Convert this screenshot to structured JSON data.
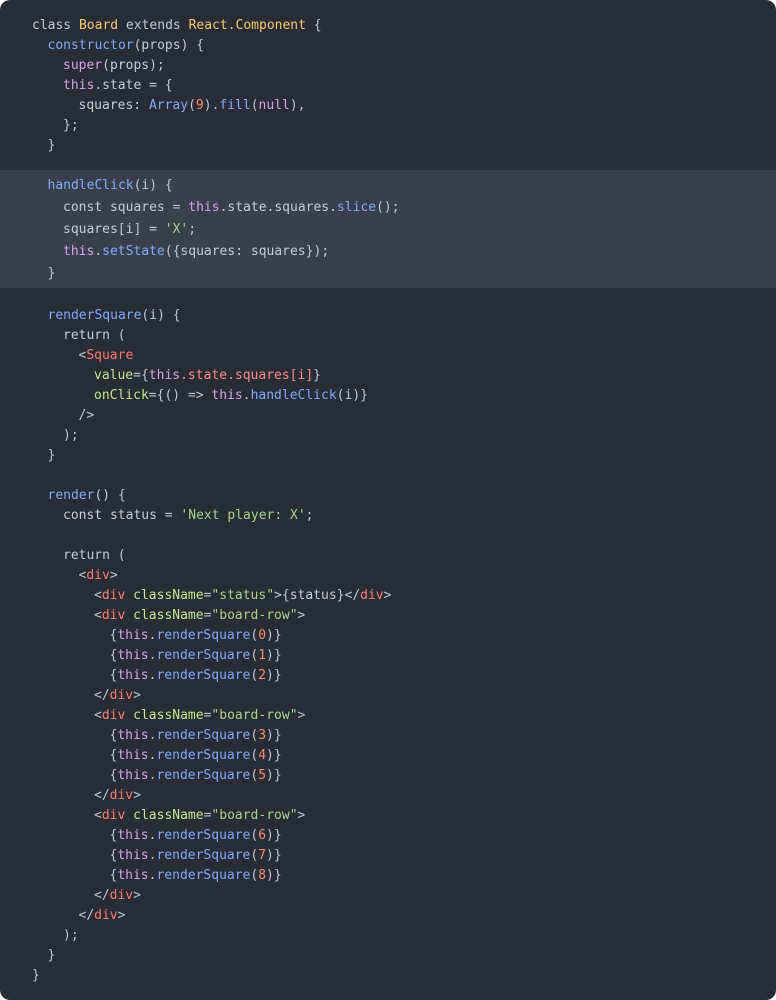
{
  "editor": {
    "highlight": {
      "from_line": 9,
      "to_line": 13
    },
    "lines": [
      {
        "indent": 0,
        "tokens": [
          {
            "t": "class ",
            "c": "keyword"
          },
          {
            "t": "Board",
            "c": "class"
          },
          {
            "t": " extends ",
            "c": "keyword"
          },
          {
            "t": "React.Component",
            "c": "class"
          },
          {
            "t": " {",
            "c": "punct"
          }
        ]
      },
      {
        "indent": 1,
        "tokens": [
          {
            "t": "constructor",
            "c": "method"
          },
          {
            "t": "(",
            "c": "punct"
          },
          {
            "t": "props",
            "c": "plain"
          },
          {
            "t": ") {",
            "c": "punct"
          }
        ]
      },
      {
        "indent": 2,
        "tokens": [
          {
            "t": "super",
            "c": "this"
          },
          {
            "t": "(",
            "c": "punct"
          },
          {
            "t": "props",
            "c": "plain"
          },
          {
            "t": ");",
            "c": "punct"
          }
        ]
      },
      {
        "indent": 2,
        "tokens": [
          {
            "t": "this",
            "c": "this"
          },
          {
            "t": ".state = {",
            "c": "plain"
          }
        ]
      },
      {
        "indent": 3,
        "tokens": [
          {
            "t": "squares",
            "c": "plain"
          },
          {
            "t": ": ",
            "c": "punct"
          },
          {
            "t": "Array",
            "c": "method"
          },
          {
            "t": "(",
            "c": "punct"
          },
          {
            "t": "9",
            "c": "number"
          },
          {
            "t": ").",
            "c": "punct"
          },
          {
            "t": "fill",
            "c": "method"
          },
          {
            "t": "(",
            "c": "punct"
          },
          {
            "t": "null",
            "c": "this"
          },
          {
            "t": "),",
            "c": "punct"
          }
        ]
      },
      {
        "indent": 2,
        "tokens": [
          {
            "t": "};",
            "c": "punct"
          }
        ]
      },
      {
        "indent": 1,
        "tokens": [
          {
            "t": "}",
            "c": "punct"
          }
        ]
      },
      {
        "indent": 0,
        "tokens": []
      },
      {
        "indent": 1,
        "tokens": [
          {
            "t": "handleClick",
            "c": "method"
          },
          {
            "t": "(",
            "c": "punct"
          },
          {
            "t": "i",
            "c": "plain"
          },
          {
            "t": ") {",
            "c": "punct"
          }
        ]
      },
      {
        "indent": 2,
        "tokens": [
          {
            "t": "const ",
            "c": "keyword"
          },
          {
            "t": "squares",
            "c": "plain"
          },
          {
            "t": " = ",
            "c": "punct"
          },
          {
            "t": "this",
            "c": "this"
          },
          {
            "t": ".state.squares.",
            "c": "plain"
          },
          {
            "t": "slice",
            "c": "method"
          },
          {
            "t": "();",
            "c": "punct"
          }
        ]
      },
      {
        "indent": 2,
        "tokens": [
          {
            "t": "squares",
            "c": "plain"
          },
          {
            "t": "[",
            "c": "punct"
          },
          {
            "t": "i",
            "c": "plain"
          },
          {
            "t": "] = ",
            "c": "punct"
          },
          {
            "t": "'X'",
            "c": "string"
          },
          {
            "t": ";",
            "c": "punct"
          }
        ]
      },
      {
        "indent": 2,
        "tokens": [
          {
            "t": "this",
            "c": "this"
          },
          {
            "t": ".",
            "c": "punct"
          },
          {
            "t": "setState",
            "c": "method"
          },
          {
            "t": "({",
            "c": "punct"
          },
          {
            "t": "squares",
            "c": "plain"
          },
          {
            "t": ": ",
            "c": "punct"
          },
          {
            "t": "squares",
            "c": "plain"
          },
          {
            "t": "});",
            "c": "punct"
          }
        ]
      },
      {
        "indent": 1,
        "tokens": [
          {
            "t": "}",
            "c": "punct"
          }
        ]
      },
      {
        "indent": 0,
        "tokens": []
      },
      {
        "indent": 1,
        "tokens": [
          {
            "t": "renderSquare",
            "c": "method"
          },
          {
            "t": "(",
            "c": "punct"
          },
          {
            "t": "i",
            "c": "plain"
          },
          {
            "t": ") {",
            "c": "punct"
          }
        ]
      },
      {
        "indent": 2,
        "tokens": [
          {
            "t": "return ",
            "c": "keyword"
          },
          {
            "t": "(",
            "c": "punct"
          }
        ]
      },
      {
        "indent": 3,
        "tokens": [
          {
            "t": "<",
            "c": "punct"
          },
          {
            "t": "Square",
            "c": "tag"
          }
        ]
      },
      {
        "indent": 4,
        "tokens": [
          {
            "t": "value",
            "c": "attr"
          },
          {
            "t": "={",
            "c": "punct"
          },
          {
            "t": "this",
            "c": "this"
          },
          {
            "t": ".state.squares[i]",
            "c": "prop"
          },
          {
            "t": "}",
            "c": "punct"
          }
        ]
      },
      {
        "indent": 4,
        "tokens": [
          {
            "t": "onClick",
            "c": "attr"
          },
          {
            "t": "={() => ",
            "c": "punct"
          },
          {
            "t": "this",
            "c": "this"
          },
          {
            "t": ".",
            "c": "punct"
          },
          {
            "t": "handleClick",
            "c": "method"
          },
          {
            "t": "(",
            "c": "punct"
          },
          {
            "t": "i",
            "c": "plain"
          },
          {
            "t": ")}",
            "c": "punct"
          }
        ]
      },
      {
        "indent": 3,
        "tokens": [
          {
            "t": "/>",
            "c": "punct"
          }
        ]
      },
      {
        "indent": 2,
        "tokens": [
          {
            "t": ");",
            "c": "punct"
          }
        ]
      },
      {
        "indent": 1,
        "tokens": [
          {
            "t": "}",
            "c": "punct"
          }
        ]
      },
      {
        "indent": 0,
        "tokens": []
      },
      {
        "indent": 1,
        "tokens": [
          {
            "t": "render",
            "c": "method"
          },
          {
            "t": "() {",
            "c": "punct"
          }
        ]
      },
      {
        "indent": 2,
        "tokens": [
          {
            "t": "const ",
            "c": "keyword"
          },
          {
            "t": "status",
            "c": "plain"
          },
          {
            "t": " = ",
            "c": "punct"
          },
          {
            "t": "'Next player: X'",
            "c": "string"
          },
          {
            "t": ";",
            "c": "punct"
          }
        ]
      },
      {
        "indent": 0,
        "tokens": []
      },
      {
        "indent": 2,
        "tokens": [
          {
            "t": "return ",
            "c": "keyword"
          },
          {
            "t": "(",
            "c": "punct"
          }
        ]
      },
      {
        "indent": 3,
        "tokens": [
          {
            "t": "<",
            "c": "punct"
          },
          {
            "t": "div",
            "c": "tag"
          },
          {
            "t": ">",
            "c": "punct"
          }
        ]
      },
      {
        "indent": 4,
        "tokens": [
          {
            "t": "<",
            "c": "punct"
          },
          {
            "t": "div",
            "c": "tag"
          },
          {
            "t": " className",
            "c": "attr"
          },
          {
            "t": "=",
            "c": "punct"
          },
          {
            "t": "\"status\"",
            "c": "string"
          },
          {
            "t": ">{",
            "c": "punct"
          },
          {
            "t": "status",
            "c": "plain"
          },
          {
            "t": "}</",
            "c": "punct"
          },
          {
            "t": "div",
            "c": "tag"
          },
          {
            "t": ">",
            "c": "punct"
          }
        ]
      },
      {
        "indent": 4,
        "tokens": [
          {
            "t": "<",
            "c": "punct"
          },
          {
            "t": "div",
            "c": "tag"
          },
          {
            "t": " className",
            "c": "attr"
          },
          {
            "t": "=",
            "c": "punct"
          },
          {
            "t": "\"board-row\"",
            "c": "string"
          },
          {
            "t": ">",
            "c": "punct"
          }
        ]
      },
      {
        "indent": 5,
        "tokens": [
          {
            "t": "{",
            "c": "punct"
          },
          {
            "t": "this",
            "c": "this"
          },
          {
            "t": ".",
            "c": "punct"
          },
          {
            "t": "renderSquare",
            "c": "method"
          },
          {
            "t": "(",
            "c": "punct"
          },
          {
            "t": "0",
            "c": "number"
          },
          {
            "t": ")}",
            "c": "punct"
          }
        ]
      },
      {
        "indent": 5,
        "tokens": [
          {
            "t": "{",
            "c": "punct"
          },
          {
            "t": "this",
            "c": "this"
          },
          {
            "t": ".",
            "c": "punct"
          },
          {
            "t": "renderSquare",
            "c": "method"
          },
          {
            "t": "(",
            "c": "punct"
          },
          {
            "t": "1",
            "c": "number"
          },
          {
            "t": ")}",
            "c": "punct"
          }
        ]
      },
      {
        "indent": 5,
        "tokens": [
          {
            "t": "{",
            "c": "punct"
          },
          {
            "t": "this",
            "c": "this"
          },
          {
            "t": ".",
            "c": "punct"
          },
          {
            "t": "renderSquare",
            "c": "method"
          },
          {
            "t": "(",
            "c": "punct"
          },
          {
            "t": "2",
            "c": "number"
          },
          {
            "t": ")}",
            "c": "punct"
          }
        ]
      },
      {
        "indent": 4,
        "tokens": [
          {
            "t": "</",
            "c": "punct"
          },
          {
            "t": "div",
            "c": "tag"
          },
          {
            "t": ">",
            "c": "punct"
          }
        ]
      },
      {
        "indent": 4,
        "tokens": [
          {
            "t": "<",
            "c": "punct"
          },
          {
            "t": "div",
            "c": "tag"
          },
          {
            "t": " className",
            "c": "attr"
          },
          {
            "t": "=",
            "c": "punct"
          },
          {
            "t": "\"board-row\"",
            "c": "string"
          },
          {
            "t": ">",
            "c": "punct"
          }
        ]
      },
      {
        "indent": 5,
        "tokens": [
          {
            "t": "{",
            "c": "punct"
          },
          {
            "t": "this",
            "c": "this"
          },
          {
            "t": ".",
            "c": "punct"
          },
          {
            "t": "renderSquare",
            "c": "method"
          },
          {
            "t": "(",
            "c": "punct"
          },
          {
            "t": "3",
            "c": "number"
          },
          {
            "t": ")}",
            "c": "punct"
          }
        ]
      },
      {
        "indent": 5,
        "tokens": [
          {
            "t": "{",
            "c": "punct"
          },
          {
            "t": "this",
            "c": "this"
          },
          {
            "t": ".",
            "c": "punct"
          },
          {
            "t": "renderSquare",
            "c": "method"
          },
          {
            "t": "(",
            "c": "punct"
          },
          {
            "t": "4",
            "c": "number"
          },
          {
            "t": ")}",
            "c": "punct"
          }
        ]
      },
      {
        "indent": 5,
        "tokens": [
          {
            "t": "{",
            "c": "punct"
          },
          {
            "t": "this",
            "c": "this"
          },
          {
            "t": ".",
            "c": "punct"
          },
          {
            "t": "renderSquare",
            "c": "method"
          },
          {
            "t": "(",
            "c": "punct"
          },
          {
            "t": "5",
            "c": "number"
          },
          {
            "t": ")}",
            "c": "punct"
          }
        ]
      },
      {
        "indent": 4,
        "tokens": [
          {
            "t": "</",
            "c": "punct"
          },
          {
            "t": "div",
            "c": "tag"
          },
          {
            "t": ">",
            "c": "punct"
          }
        ]
      },
      {
        "indent": 4,
        "tokens": [
          {
            "t": "<",
            "c": "punct"
          },
          {
            "t": "div",
            "c": "tag"
          },
          {
            "t": " className",
            "c": "attr"
          },
          {
            "t": "=",
            "c": "punct"
          },
          {
            "t": "\"board-row\"",
            "c": "string"
          },
          {
            "t": ">",
            "c": "punct"
          }
        ]
      },
      {
        "indent": 5,
        "tokens": [
          {
            "t": "{",
            "c": "punct"
          },
          {
            "t": "this",
            "c": "this"
          },
          {
            "t": ".",
            "c": "punct"
          },
          {
            "t": "renderSquare",
            "c": "method"
          },
          {
            "t": "(",
            "c": "punct"
          },
          {
            "t": "6",
            "c": "number"
          },
          {
            "t": ")}",
            "c": "punct"
          }
        ]
      },
      {
        "indent": 5,
        "tokens": [
          {
            "t": "{",
            "c": "punct"
          },
          {
            "t": "this",
            "c": "this"
          },
          {
            "t": ".",
            "c": "punct"
          },
          {
            "t": "renderSquare",
            "c": "method"
          },
          {
            "t": "(",
            "c": "punct"
          },
          {
            "t": "7",
            "c": "number"
          },
          {
            "t": ")}",
            "c": "punct"
          }
        ]
      },
      {
        "indent": 5,
        "tokens": [
          {
            "t": "{",
            "c": "punct"
          },
          {
            "t": "this",
            "c": "this"
          },
          {
            "t": ".",
            "c": "punct"
          },
          {
            "t": "renderSquare",
            "c": "method"
          },
          {
            "t": "(",
            "c": "punct"
          },
          {
            "t": "8",
            "c": "number"
          },
          {
            "t": ")}",
            "c": "punct"
          }
        ]
      },
      {
        "indent": 4,
        "tokens": [
          {
            "t": "</",
            "c": "punct"
          },
          {
            "t": "div",
            "c": "tag"
          },
          {
            "t": ">",
            "c": "punct"
          }
        ]
      },
      {
        "indent": 3,
        "tokens": [
          {
            "t": "</",
            "c": "punct"
          },
          {
            "t": "div",
            "c": "tag"
          },
          {
            "t": ">",
            "c": "punct"
          }
        ]
      },
      {
        "indent": 2,
        "tokens": [
          {
            "t": ");",
            "c": "punct"
          }
        ]
      },
      {
        "indent": 1,
        "tokens": [
          {
            "t": "}",
            "c": "punct"
          }
        ]
      },
      {
        "indent": 0,
        "tokens": [
          {
            "t": "}",
            "c": "punct"
          }
        ]
      }
    ]
  }
}
